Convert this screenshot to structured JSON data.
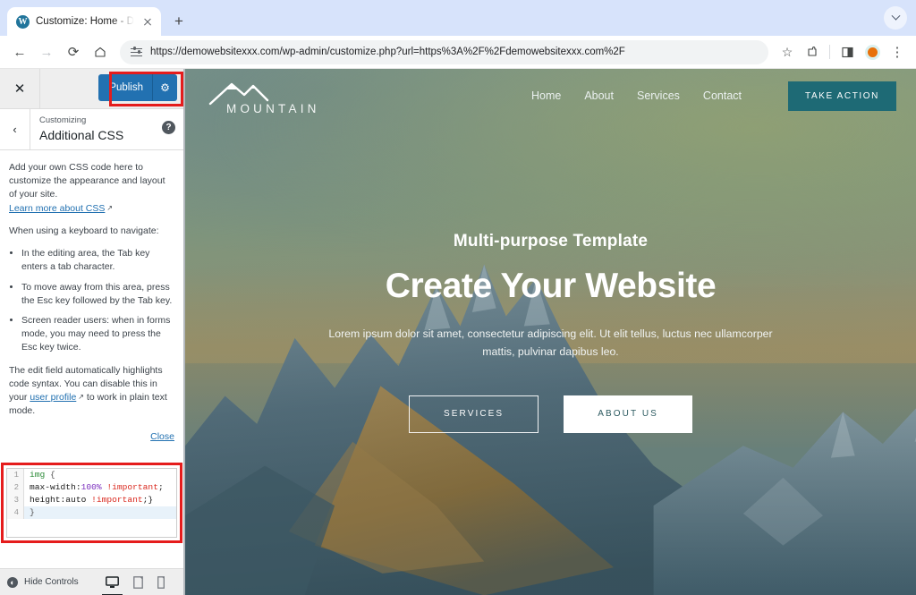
{
  "browser": {
    "tab": {
      "title": "Customize: Home - Demo We",
      "favicon": "wordpress-icon",
      "close": "×"
    },
    "new_tab_label": "+",
    "tab_search_icon": "chevron-down-icon",
    "nav": {
      "back": "←",
      "forward": "→",
      "reload": "⟳",
      "home": "⌂"
    },
    "omnibox": {
      "url": "https://demowebsitexxx.com/wp-admin/customize.php?url=https%3A%2F%2Fdemowebsitexxx.com%2F",
      "site_settings_icon": "tune-icon"
    },
    "actions": {
      "bookmark": "☆",
      "extensions": "extensions-icon",
      "split_view": "split-view-icon",
      "profile": "profile-avatar",
      "menu": "⋮"
    }
  },
  "customizer": {
    "close_label": "✕",
    "publish": {
      "label": "Publish",
      "gear": "⚙",
      "color": "#2271b1"
    },
    "back_label": "‹",
    "eyebrow": "Customizing",
    "title": "Additional CSS",
    "help_label": "?",
    "description": {
      "intro": "Add your own CSS code here to customize the appearance and layout of your site.",
      "learn_more": "Learn more about CSS",
      "keyboard_intro": "When using a keyboard to navigate:",
      "bullets": [
        "In the editing area, the Tab key enters a tab character.",
        "To move away from this area, press the Esc key followed by the Tab key.",
        "Screen reader users: when in forms mode, you may need to press the Esc key twice."
      ],
      "syntax_before": "The edit field automatically highlights code syntax. You can disable this in your ",
      "syntax_link": "user profile",
      "syntax_after": " to work in plain text mode."
    },
    "close_link": "Close",
    "editor": {
      "lines": [
        {
          "num": "1",
          "tokens": [
            {
              "t": "img ",
              "c": "t-tag"
            },
            {
              "t": "{",
              "c": "t-brc"
            }
          ]
        },
        {
          "num": "2",
          "tokens": [
            {
              "t": "max-width:",
              "c": "t-prop"
            },
            {
              "t": "100%",
              "c": "t-num"
            },
            {
              "t": " ",
              "c": "t-prop"
            },
            {
              "t": "!important",
              "c": "t-imp"
            },
            {
              "t": ";",
              "c": "t-prop"
            }
          ]
        },
        {
          "num": "3",
          "tokens": [
            {
              "t": "height:auto ",
              "c": "t-prop"
            },
            {
              "t": "!important",
              "c": "t-imp"
            },
            {
              "t": ";}",
              "c": "t-prop"
            }
          ]
        },
        {
          "num": "4",
          "tokens": [
            {
              "t": "}",
              "c": "t-brc"
            }
          ]
        }
      ],
      "highlight_color": "#e51c1c"
    },
    "footer": {
      "hide_controls": "Hide Controls",
      "devices": [
        {
          "name": "desktop",
          "active": true
        },
        {
          "name": "tablet",
          "active": false
        },
        {
          "name": "mobile",
          "active": false
        }
      ]
    }
  },
  "site": {
    "logo": {
      "text": "MOUNTAIN",
      "mark": "mountain-peaks-icon"
    },
    "nav": [
      "Home",
      "About",
      "Services",
      "Contact"
    ],
    "cta": {
      "label": "TAKE ACTION",
      "color": "#1e6a75"
    },
    "hero": {
      "subtitle": "Multi-purpose Template",
      "title": "Create Your Website",
      "paragraph": "Lorem ipsum dolor sit amet, consectetur adipiscing elit. Ut elit tellus, luctus nec ullamcorper mattis, pulvinar dapibus leo.",
      "buttons": [
        "SERVICES",
        "ABOUT US"
      ]
    }
  }
}
